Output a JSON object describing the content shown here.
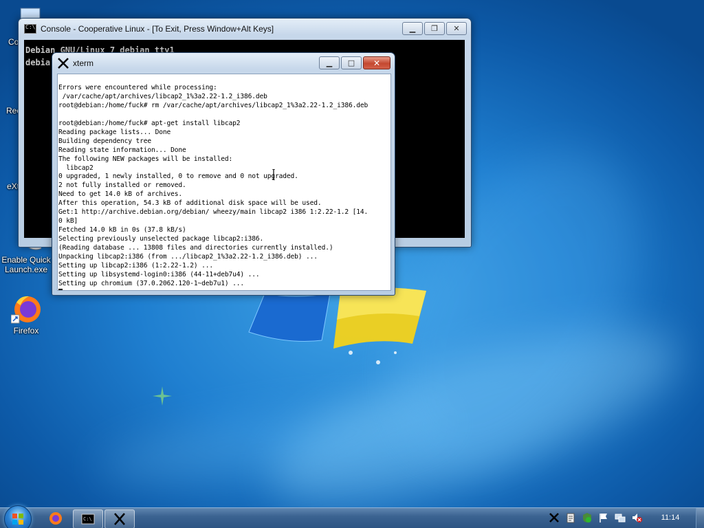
{
  "desktop": {
    "icons": [
      {
        "label": "Co",
        "icon": "computer-icon"
      },
      {
        "label": "Rec",
        "icon": "recycle-bin-icon"
      },
      {
        "label": "eXt",
        "icon": "folder-icon"
      },
      {
        "label": "Enable Quick Launch.exe",
        "icon": "program-icon"
      },
      {
        "label": "Firefox",
        "icon": "firefox-icon"
      }
    ]
  },
  "console_window": {
    "title": "Console - Cooperative Linux - [To Exit, Press Window+Alt Keys]",
    "lines": [
      "Debian GNU/Linux 7 debian tty1",
      "debia"
    ]
  },
  "xterm_window": {
    "title": "xterm",
    "lines": [
      "Errors were encountered while processing:",
      " /var/cache/apt/archives/libcap2_1%3a2.22-1.2_i386.deb",
      "root@debian:/home/fuck# rm /var/cache/apt/archives/libcap2_1%3a2.22-1.2_i386.deb",
      "",
      "root@debian:/home/fuck# apt-get install libcap2",
      "Reading package lists... Done",
      "Building dependency tree",
      "Reading state information... Done",
      "The following NEW packages will be installed:",
      "  libcap2",
      "0 upgraded, 1 newly installed, 0 to remove and 0 not upgraded.",
      "2 not fully installed or removed.",
      "Need to get 14.0 kB of archives.",
      "After this operation, 54.3 kB of additional disk space will be used.",
      "Get:1 http://archive.debian.org/debian/ wheezy/main libcap2 i386 1:2.22-1.2 [14.",
      "0 kB]",
      "Fetched 14.0 kB in 0s (37.8 kB/s)",
      "Selecting previously unselected package libcap2:i386.",
      "(Reading database ... 13808 files and directories currently installed.)",
      "Unpacking libcap2:i386 (from .../libcap2_1%3a2.22-1.2_i386.deb) ...",
      "Setting up libcap2:i386 (1:2.22-1.2) ...",
      "Setting up libsystemd-login0:i386 (44-11+deb7u4) ...",
      "Setting up chromium (37.0.2062.120-1~deb7u1) ..."
    ]
  },
  "taskbar": {
    "start": "start-orb",
    "buttons": [
      "firefox",
      "console",
      "xterm"
    ],
    "tray_icons": [
      "x-server-icon",
      "clipboard-icon",
      "security-icon",
      "flag-icon",
      "network-icon",
      "volume-muted-icon"
    ],
    "clock": "11:14"
  },
  "colors": {
    "desktop_blue": "#1f7fd0",
    "console_bg": "#000000",
    "xterm_bg": "#ffffff",
    "close_red": "#c44830"
  }
}
